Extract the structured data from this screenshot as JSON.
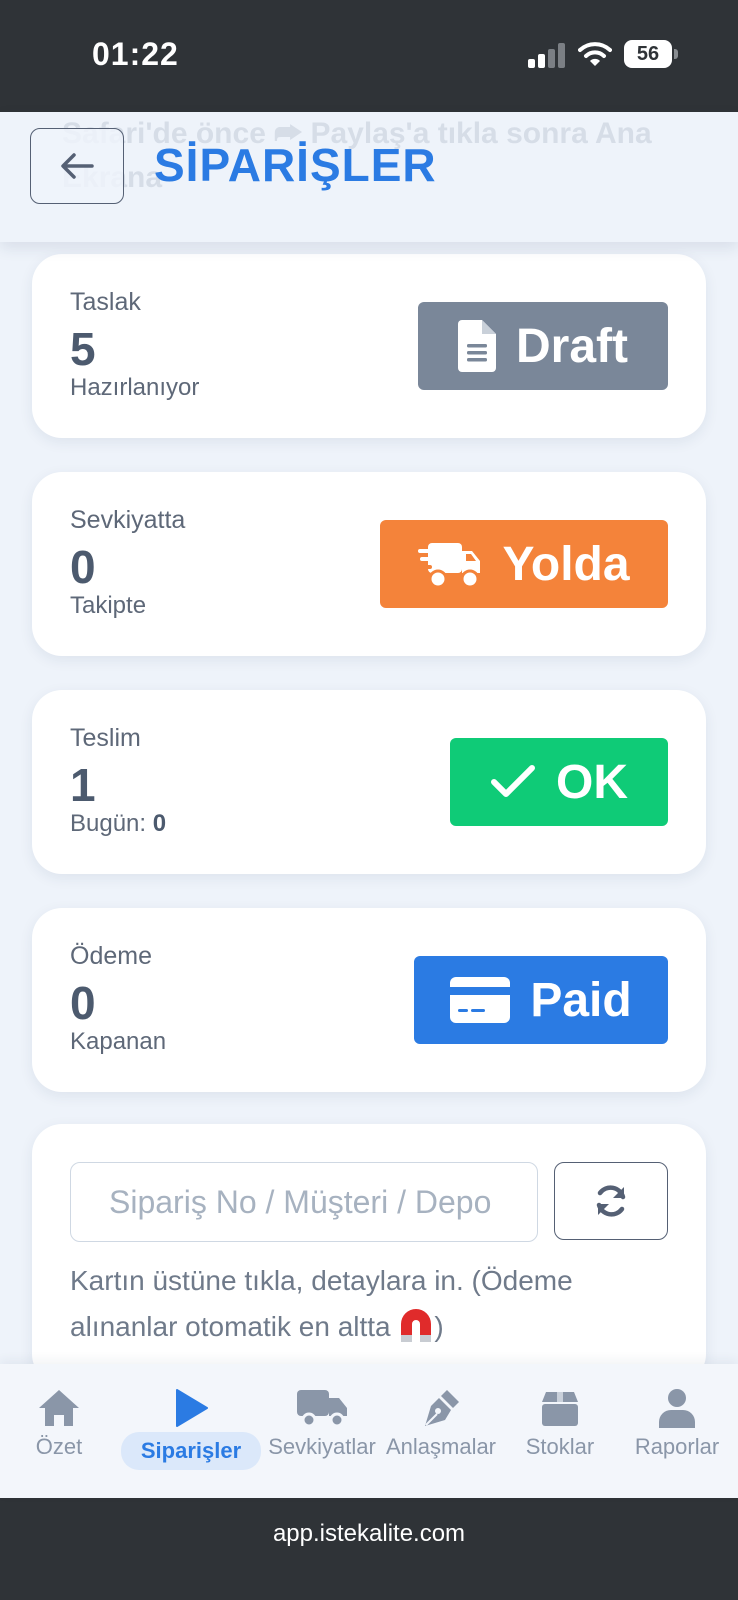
{
  "status_bar": {
    "time": "01:22",
    "battery": "56"
  },
  "header": {
    "ghost_text": "Safari'de önce ⮫ Paylaş'a tıkla sonra Ana Ekrana",
    "title": "SİPARİŞLER"
  },
  "cards": [
    {
      "label": "Taslak",
      "value": "5",
      "sub": "Hazırlanıyor",
      "badge": "Draft",
      "icon": "file-icon",
      "color": "#7a8799"
    },
    {
      "label": "Sevkiyatta",
      "value": "0",
      "sub": "Takipte",
      "badge": "Yolda",
      "icon": "truck-icon",
      "color": "#f4833a"
    },
    {
      "label": "Teslim",
      "value": "1",
      "sub_prefix": "Bugün:",
      "sub_value": "0",
      "badge": "OK",
      "icon": "check-icon",
      "color": "#0fcb77"
    },
    {
      "label": "Ödeme",
      "value": "0",
      "sub": "Kapanan",
      "badge": "Paid",
      "icon": "credit-card-icon",
      "color": "#2b7be3"
    }
  ],
  "search": {
    "placeholder": "Sipariş No / Müşteri / Depo",
    "hint": "Kartın üstüne tıkla, detaylara in. (Ödeme alınanlar otomatik en altta",
    "hint_end": ")"
  },
  "nav": {
    "items": [
      {
        "label": "Özet",
        "icon": "home-icon"
      },
      {
        "label": "Siparişler",
        "icon": "play-icon",
        "active": true
      },
      {
        "label": "Sevkiyatlar",
        "icon": "truck-icon"
      },
      {
        "label": "Anlaşmalar",
        "icon": "pen-nib-icon"
      },
      {
        "label": "Stoklar",
        "icon": "box-icon"
      },
      {
        "label": "Raporlar",
        "icon": "user-icon"
      }
    ]
  },
  "url": "app.istekalite.com",
  "colors": {
    "accent": "#2b7be3",
    "background": "#eef3fa"
  }
}
